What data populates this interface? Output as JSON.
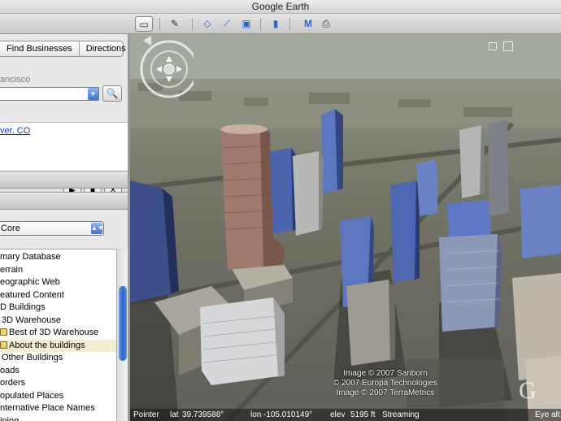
{
  "window": {
    "title": "Google Earth"
  },
  "toolbar": {
    "sidebar_toggle": "▭",
    "placemark": "✎",
    "polygon": "◇",
    "path": "⟋",
    "overlay": "▣",
    "ruler": "▮",
    "email": "M",
    "print": "⎙",
    "icons": [
      "sidebar-icon",
      "placemark-icon",
      "polygon-icon",
      "path-icon",
      "image-overlay-icon",
      "ruler-icon",
      "email-icon",
      "print-icon"
    ]
  },
  "search": {
    "tabs": [
      "Find Businesses",
      "Directions"
    ],
    "label": "ancisco",
    "input_value": "",
    "go_icon": "🔍",
    "result": "ver, CO"
  },
  "tour_controls": {
    "play": "▶",
    "stop": "■",
    "close": "✕"
  },
  "layers": {
    "selected_view": "Core",
    "items": [
      "mary Database",
      "errain",
      "eographic Web",
      "eatured Content",
      "D Buildings",
      "3D Warehouse",
      "Best of 3D Warehouse",
      "About the buildings",
      "Other Buildings",
      "oads",
      "orders",
      "opulated Places",
      "nternative Place Names",
      "ining"
    ]
  },
  "view": {
    "attribution": [
      "Image © 2007 Sanborn",
      "© 2007 Europa Technologies",
      "Image © 2007 TerraMetrics"
    ],
    "logo": "G",
    "status": {
      "pointer": "Pointer",
      "lat_label": "lat",
      "lat": "39.739588°",
      "lon_label": "lon",
      "lon": "-105.010149°",
      "elev_label": "elev",
      "elev": "5195 ft",
      "streaming": "Streaming",
      "eye_alt": "Eye alt"
    }
  }
}
